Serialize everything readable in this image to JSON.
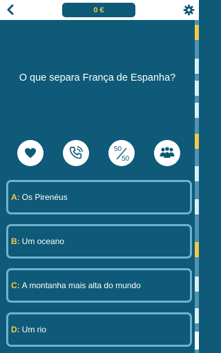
{
  "header": {
    "money_label": "0 €",
    "back_icon": "chevron-left-icon",
    "settings_icon": "gear-icon"
  },
  "question": {
    "text": "O que separa França de Espanha?"
  },
  "lifelines": [
    {
      "name": "heart-icon"
    },
    {
      "name": "phone-icon"
    },
    {
      "name": "fifty-fifty-icon",
      "top": "50",
      "bottom": "50"
    },
    {
      "name": "audience-icon"
    }
  ],
  "answers": [
    {
      "letter": "A:",
      "text": "Os Pirenéus"
    },
    {
      "letter": "B:",
      "text": "Um oceano"
    },
    {
      "letter": "C:",
      "text": "A montanha mais alta do mundo"
    },
    {
      "letter": "D:",
      "text": "Um rio"
    }
  ],
  "colors": {
    "background": "#0e5a78",
    "accent": "#f2c94c",
    "answer_border": "#6fb2cf"
  }
}
